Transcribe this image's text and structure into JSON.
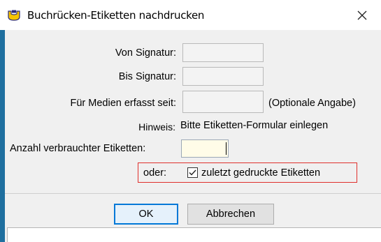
{
  "window": {
    "title": "Buchrücken-Etiketten nachdrucken",
    "app_icon": "library-app-icon",
    "close_icon": "close-icon"
  },
  "form": {
    "von_signatur_label": "Von Signatur:",
    "von_signatur_value": "",
    "bis_signatur_label": "Bis Signatur:",
    "bis_signatur_value": "",
    "medien_label": "Für Medien erfasst seit:",
    "medien_value": "",
    "medien_hint": "(Optionale Angabe)",
    "hinweis_label": "Hinweis:",
    "hinweis_text": "Bitte Etiketten-Formular einlegen",
    "anzahl_label": "Anzahl verbrauchter Etiketten:",
    "anzahl_value": "",
    "oder_label": "oder:",
    "checkbox_label": "zuletzt gedruckte Etiketten",
    "checkbox_checked": true
  },
  "buttons": {
    "ok_label": "OK",
    "cancel_label": "Abbrechen"
  },
  "colors": {
    "highlight_border": "#e0302c",
    "window_strip": "#1f6f9f",
    "active_field_bg": "#fffce8",
    "default_button_border": "#0078d7"
  }
}
